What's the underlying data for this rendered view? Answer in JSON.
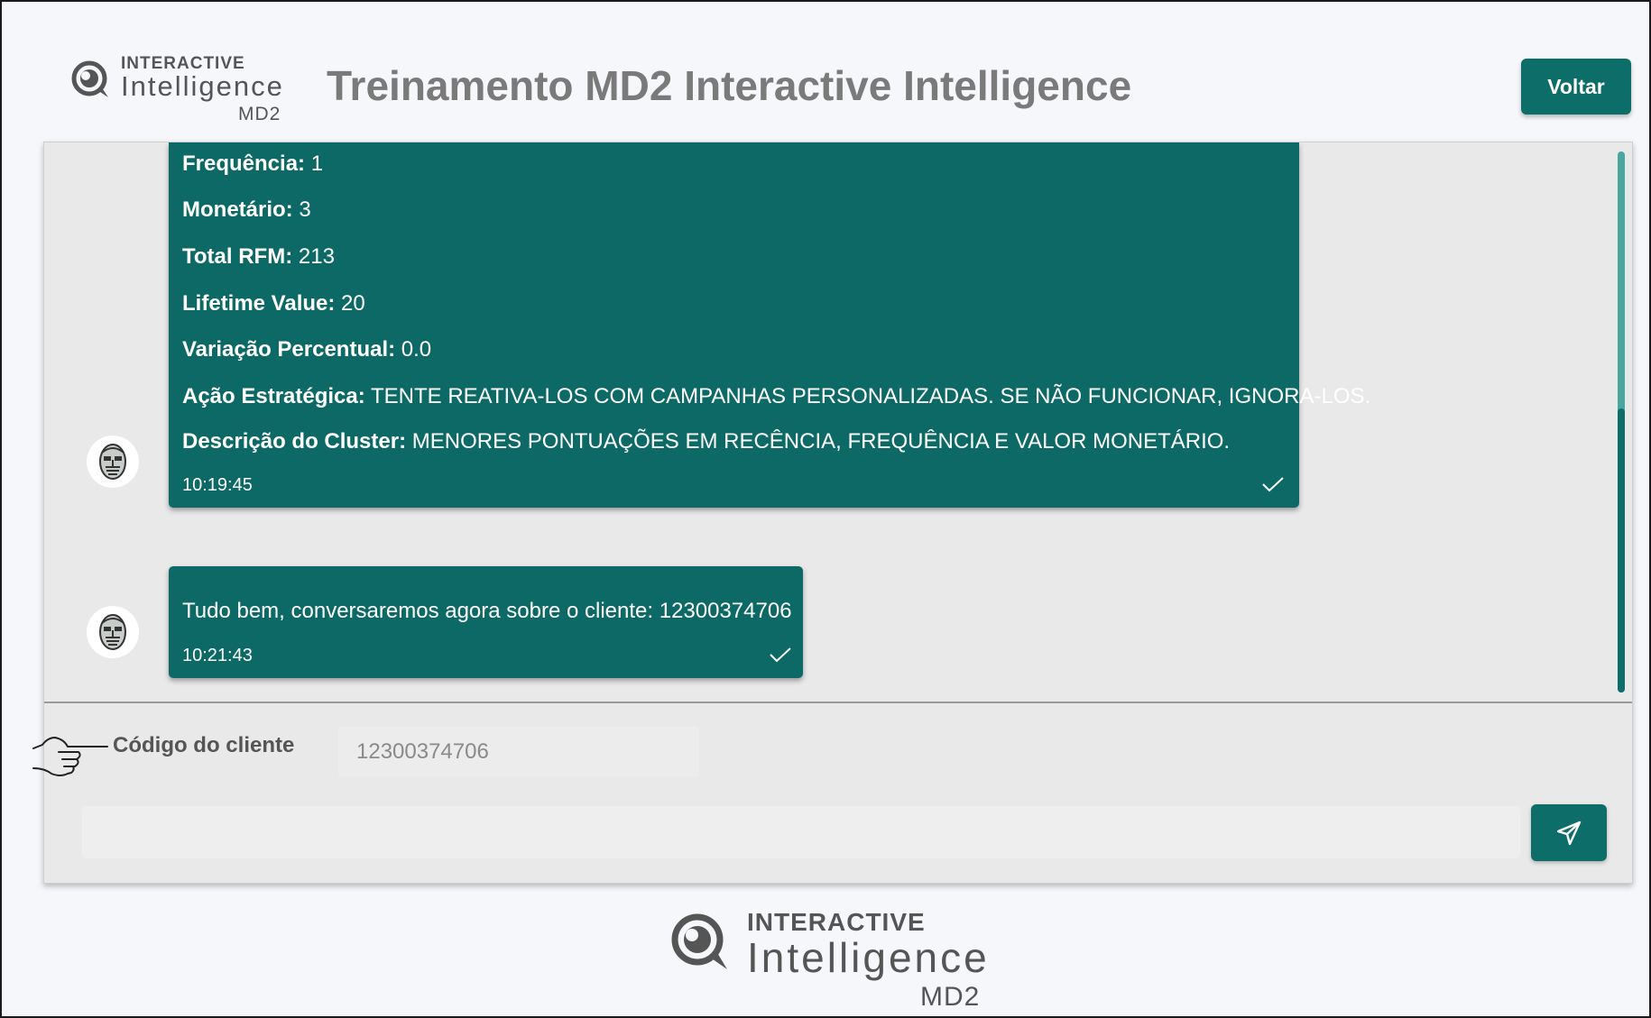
{
  "header": {
    "logo_line1": "INTERACTIVE",
    "logo_line2": "Intelligence",
    "logo_line3": "MD2",
    "title": "Treinamento MD2 Interactive Intelligence",
    "back_label": "Voltar"
  },
  "messages": [
    {
      "fields": [
        {
          "label": "Frequência:",
          "value": " 1"
        },
        {
          "label": "Monetário:",
          "value": " 3"
        },
        {
          "label": "Total RFM:",
          "value": " 213"
        },
        {
          "label": "Lifetime Value:",
          "value": " 20"
        },
        {
          "label": "Variação Percentual:",
          "value": " 0.0"
        },
        {
          "label": "Ação Estratégica:",
          "value": " TENTE REATIVA-LOS COM CAMPANHAS PERSONALIZADAS. SE NÃO FUNCIONAR, IGNORA-LOS."
        },
        {
          "label": "Descrição do Cluster:",
          "value": " MENORES PONTUAÇÕES EM RECÊNCIA, FREQUÊNCIA E VALOR MONETÁRIO."
        }
      ],
      "time": "10:19:45"
    },
    {
      "text": "Tudo bem, conversaremos agora sobre o cliente: 12300374706",
      "time": "10:21:43"
    }
  ],
  "input": {
    "code_label": "Código do cliente",
    "code_value": "12300374706",
    "message_value": ""
  },
  "footer": {
    "logo_line1": "INTERACTIVE",
    "logo_line2": "Intelligence",
    "logo_line3": "MD2"
  },
  "colors": {
    "accent": "#0d6d68",
    "bubble": "#0c6966",
    "panel": "#e9e9e9",
    "background": "#f5f7fb"
  },
  "icons": {
    "logo": "magnifier-logo-icon",
    "avatar": "robot-face-icon",
    "check": "checkmark-icon",
    "send": "paper-plane-icon",
    "pointer": "pointing-hand-icon"
  }
}
